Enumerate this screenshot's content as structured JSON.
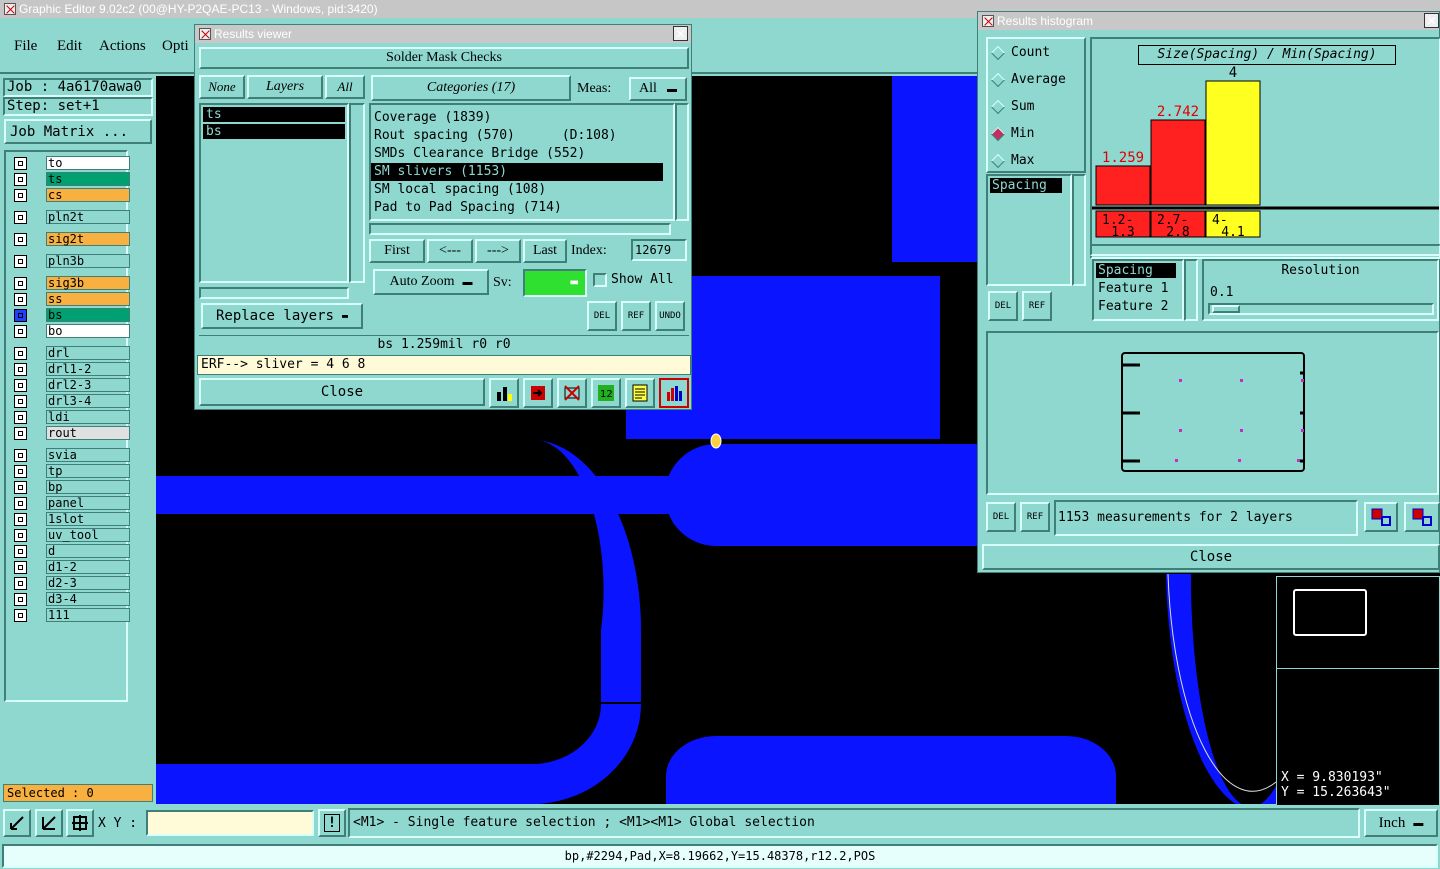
{
  "app": {
    "title": "Graphic Editor 9.02c2 (00@HY-P2QAE-PC13 - Windows, pid:3420)"
  },
  "menu": [
    "File",
    "Edit",
    "Actions",
    "Opti"
  ],
  "job": {
    "job_label": "Job : 4a6170awa0",
    "step_label": "Step: set+1",
    "matrix_button": "Job Matrix ..."
  },
  "layers": [
    {
      "name": "to",
      "color": "#ffffff"
    },
    {
      "name": "ts",
      "color": "#00a070"
    },
    {
      "name": "cs",
      "color": "#f8b040"
    },
    {
      "name": "pln2t",
      "color": "#8fd8d0"
    },
    {
      "name": "sig2t",
      "color": "#f8b040"
    },
    {
      "name": "pln3b",
      "color": "#8fd8d0"
    },
    {
      "name": "sig3b",
      "color": "#f8b040"
    },
    {
      "name": "ss",
      "color": "#f8b040"
    },
    {
      "name": "bs",
      "color": "#00a070"
    },
    {
      "name": "bo",
      "color": "#ffffff"
    },
    {
      "name": "drl",
      "color": "#8fd8d0"
    },
    {
      "name": "drl1-2",
      "color": "#8fd8d0"
    },
    {
      "name": "drl2-3",
      "color": "#8fd8d0"
    },
    {
      "name": "drl3-4",
      "color": "#8fd8d0"
    },
    {
      "name": "ldi",
      "color": "#8fd8d0"
    },
    {
      "name": "rout",
      "color": "#e0e0e0"
    },
    {
      "name": "svia",
      "color": "#8fd8d0"
    },
    {
      "name": "tp",
      "color": "#8fd8d0"
    },
    {
      "name": "bp",
      "color": "#8fd8d0"
    },
    {
      "name": "panel",
      "color": "#8fd8d0"
    },
    {
      "name": "1slot",
      "color": "#8fd8d0"
    },
    {
      "name": "uv_tool",
      "color": "#8fd8d0"
    },
    {
      "name": "d",
      "color": "#8fd8d0"
    },
    {
      "name": "d1-2",
      "color": "#8fd8d0"
    },
    {
      "name": "d2-3",
      "color": "#8fd8d0"
    },
    {
      "name": "d3-4",
      "color": "#8fd8d0"
    },
    {
      "name": "111",
      "color": "#8fd8d0"
    }
  ],
  "selected": "Selected : 0",
  "results_viewer": {
    "title": "Results viewer",
    "header": "Solder Mask Checks",
    "none": "None",
    "layers": "Layers",
    "all": "All",
    "categories": "Categories (17)",
    "meas_label": "Meas:",
    "meas_value": "All",
    "layer_list": [
      "ts",
      "bs"
    ],
    "category_list": [
      "Coverage (1839)",
      "Rout spacing (570)      (D:108)",
      "SMDs Clearance Bridge (552)",
      "SM slivers (1153)",
      "SM local spacing (108)",
      "Pad to Pad Spacing (714)"
    ],
    "first": "First",
    "prev": "<---",
    "next": "--->",
    "last": "Last",
    "index_label": "Index:",
    "index_value": "12679",
    "auto_zoom": "Auto Zoom",
    "sv": "Sv:",
    "show_all": "Show All",
    "replace_layers": "Replace layers",
    "del": "DEL",
    "ref": "REF",
    "undo": "UNDO",
    "status": "bs 1.259mil  r0  r0",
    "erf": "ERF--> sliver = 4 6 8",
    "close": "Close"
  },
  "histogram": {
    "title": "Results histogram",
    "modes": [
      "Count",
      "Average",
      "Sum",
      "Min",
      "Max"
    ],
    "selected_mode": "Min",
    "measure_list": [
      "Spacing"
    ],
    "chart_title": "Size(Spacing) / Min(Spacing)",
    "axis_list": [
      "Spacing",
      "Feature 1",
      "Feature 2"
    ],
    "resolution_label": "Resolution",
    "resolution_value": "0.1",
    "summary": "1153 measurements for 2 layers",
    "close": "Close",
    "del": "DEL",
    "ref": "REF"
  },
  "chart_data": {
    "type": "bar",
    "title": "Size(Spacing) / Min(Spacing)",
    "categories": [
      "1.2-1.3",
      "2.7-2.8",
      "4-4.1"
    ],
    "category_lines": [
      [
        "1.2-",
        "1.3"
      ],
      [
        "2.7-",
        "2.8"
      ],
      [
        "4-",
        "4.1"
      ]
    ],
    "values": [
      1.259,
      2.742,
      4
    ],
    "value_labels": [
      "1.259",
      "2.742",
      "4"
    ],
    "colors": [
      "#ff2020",
      "#ff2020",
      "#ffff20"
    ],
    "ylim": [
      0,
      4
    ]
  },
  "coords": {
    "x": "X = 9.830193\"",
    "y": "Y = 15.263643\""
  },
  "bottom": {
    "xy_label": "X Y :",
    "xy_value": "",
    "hint": "<M1> - Single feature selection ; <M1><M1> Global selection",
    "units": "Inch",
    "status": "bp,#2294,Pad,X=8.19662,Y=15.48378,r12.2,POS"
  }
}
